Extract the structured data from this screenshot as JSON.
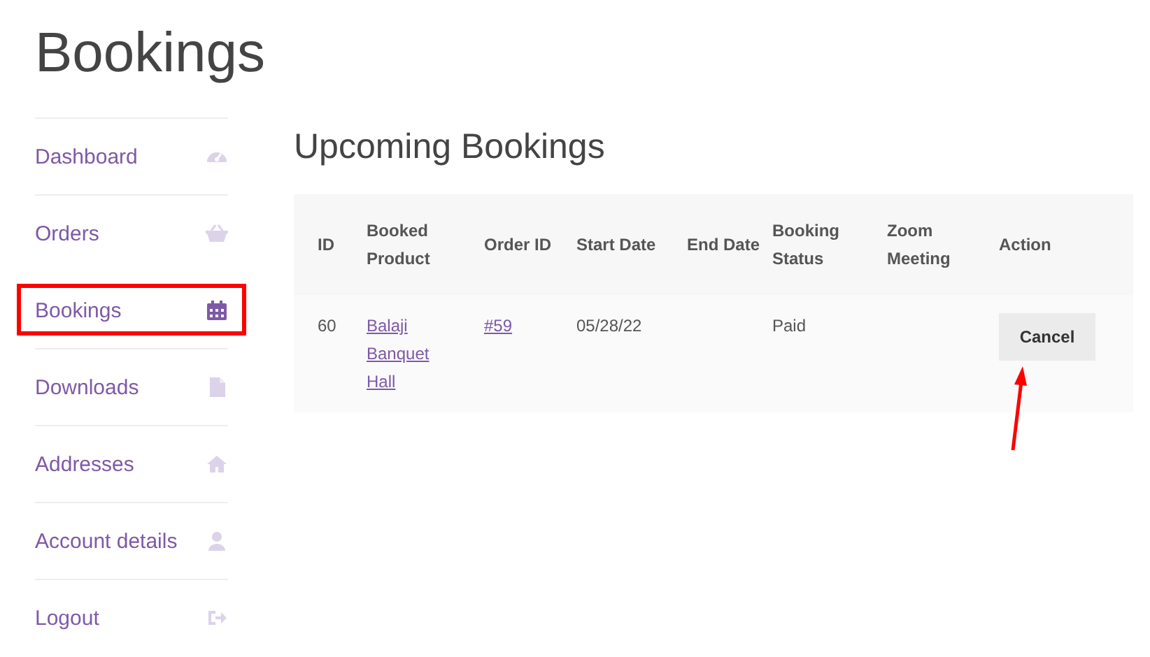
{
  "page_title": "Bookings",
  "nav": [
    {
      "label": "Dashboard",
      "kind": "gauge",
      "selected": false,
      "highlighted": false
    },
    {
      "label": "Orders",
      "kind": "basket",
      "selected": false,
      "highlighted": false
    },
    {
      "label": "Bookings",
      "kind": "calendar",
      "selected": true,
      "highlighted": true
    },
    {
      "label": "Downloads",
      "kind": "file",
      "selected": false,
      "highlighted": false
    },
    {
      "label": "Addresses",
      "kind": "home",
      "selected": false,
      "highlighted": false
    },
    {
      "label": "Account details",
      "kind": "user",
      "selected": false,
      "highlighted": false
    },
    {
      "label": "Logout",
      "kind": "logout",
      "selected": false,
      "highlighted": false
    }
  ],
  "section_title": "Upcoming Bookings",
  "table": {
    "columns": [
      "ID",
      "Booked Product",
      "Order ID",
      "Start Date",
      "End Date",
      "Booking Status",
      "Zoom Meeting",
      "Action"
    ],
    "rows": [
      {
        "id": "60",
        "product": "Balaji Banquet Hall",
        "order": "#59",
        "start": "05/28/22",
        "status": "Paid",
        "action": {
          "label": "Cancel",
          "marked": true
        }
      }
    ]
  }
}
